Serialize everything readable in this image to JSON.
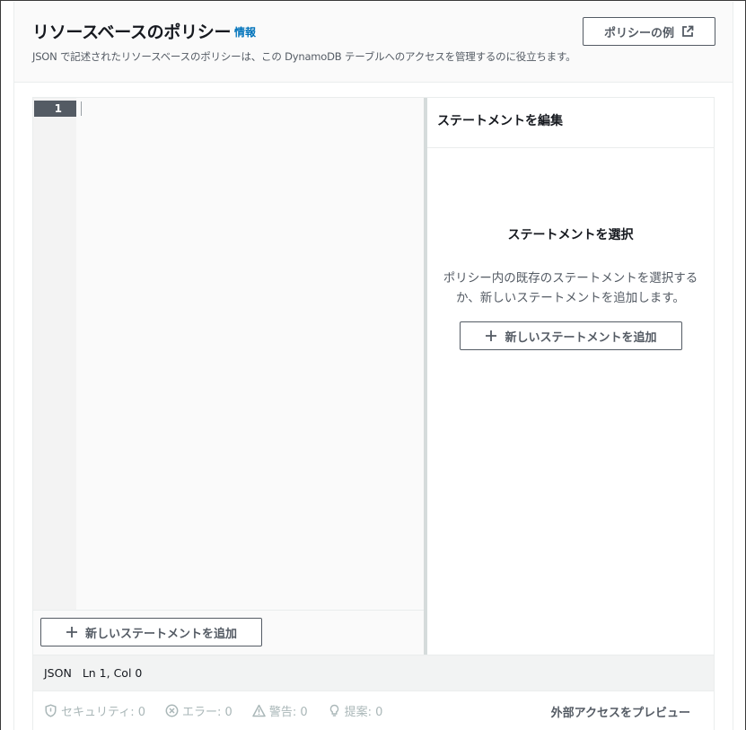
{
  "header": {
    "title": "リソースベースのポリシー",
    "info_link": "情報",
    "subtitle": "JSON で記述されたリソースベースのポリシーは、この DynamoDB テーブルへのアクセスを管理するのに役立ちます。",
    "examples_button": "ポリシーの例"
  },
  "editor": {
    "line_number": "1",
    "add_statement_button": "新しいステートメントを追加"
  },
  "side_panel": {
    "title": "ステートメントを編集",
    "empty_title": "ステートメントを選択",
    "empty_description": "ポリシー内の既存のステートメントを選択するか、新しいステートメントを追加します。",
    "add_statement_button": "新しいステートメントを追加"
  },
  "status_bar": {
    "language": "JSON",
    "position": "Ln 1, Col 0"
  },
  "lint_bar": {
    "security": "セキュリティ: 0",
    "errors": "エラー: 0",
    "warnings": "警告: 0",
    "suggestions": "提案: 0",
    "preview_button": "外部アクセスをプレビュー"
  },
  "colors": {
    "link": "#0073bb",
    "button_text": "#545b64",
    "disabled_text": "#aab7b8"
  }
}
